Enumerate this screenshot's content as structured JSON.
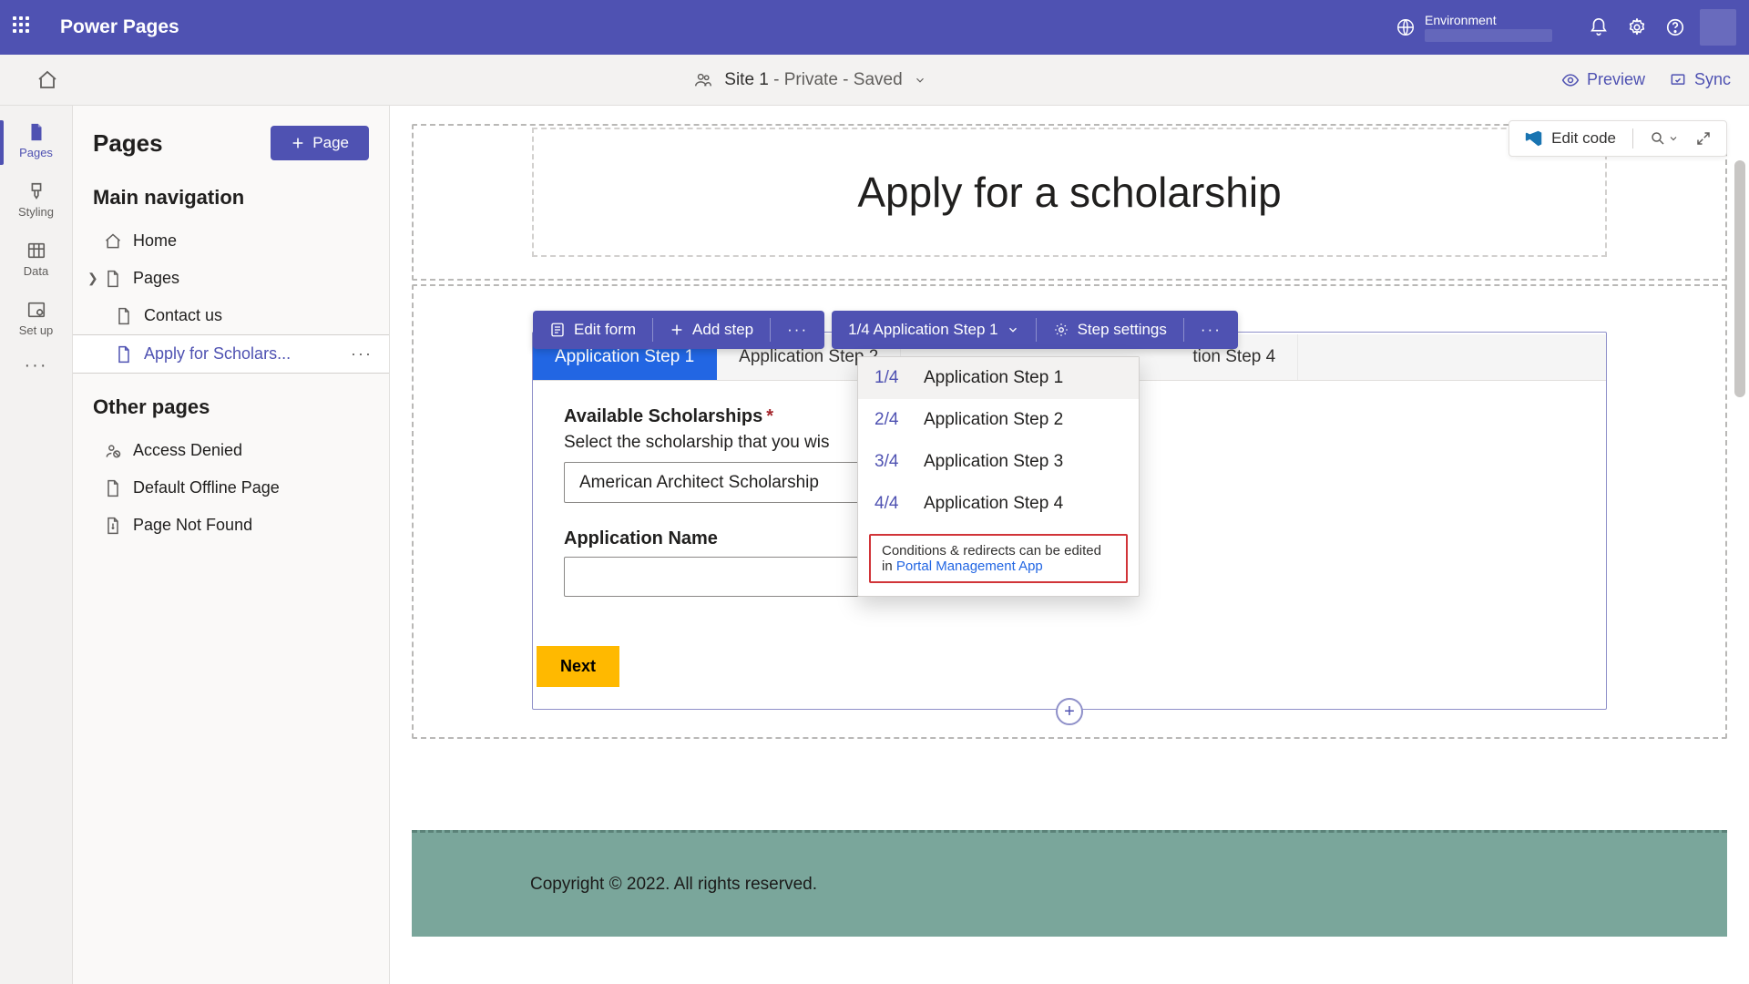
{
  "topbar": {
    "brand": "Power Pages",
    "env_label": "Environment"
  },
  "cmdbar": {
    "site_name": "Site 1",
    "site_suffix": " - Private - Saved",
    "preview": "Preview",
    "sync": "Sync"
  },
  "rail": {
    "pages": "Pages",
    "styling": "Styling",
    "data": "Data",
    "setup": "Set up"
  },
  "panel": {
    "title": "Pages",
    "add_button": "Page",
    "nav_heading": "Main navigation",
    "other_heading": "Other pages",
    "nav_items": {
      "home": "Home",
      "pages": "Pages",
      "contact": "Contact us",
      "apply": "Apply for Scholars..."
    },
    "other_items": {
      "denied": "Access Denied",
      "offline": "Default Offline Page",
      "notfound": "Page Not Found"
    }
  },
  "canvas": {
    "edit_code": "Edit code",
    "page_title": "Apply for a scholarship",
    "toolbar": {
      "edit_form": "Edit form",
      "add_step": "Add step",
      "step_indicator": "1/4 Application Step 1",
      "step_settings": "Step settings"
    },
    "tabs": [
      "Application Step 1",
      "Application Step 2",
      "Application Step 3",
      "Application Step 4"
    ],
    "tab4_partial": "tion Step 4",
    "form": {
      "label1": "Available Scholarships",
      "help1": "Select the scholarship that you wis",
      "select_value": "American Architect Scholarship",
      "label2": "Application Name",
      "next": "Next"
    },
    "dropdown": {
      "items": [
        {
          "num": "1/4",
          "label": "Application Step 1"
        },
        {
          "num": "2/4",
          "label": "Application Step 2"
        },
        {
          "num": "3/4",
          "label": "Application Step 3"
        },
        {
          "num": "4/4",
          "label": "Application Step 4"
        }
      ],
      "note_text": "Conditions & redirects can be edited in ",
      "note_link": "Portal Management App"
    },
    "footer": "Copyright © 2022. All rights reserved."
  }
}
